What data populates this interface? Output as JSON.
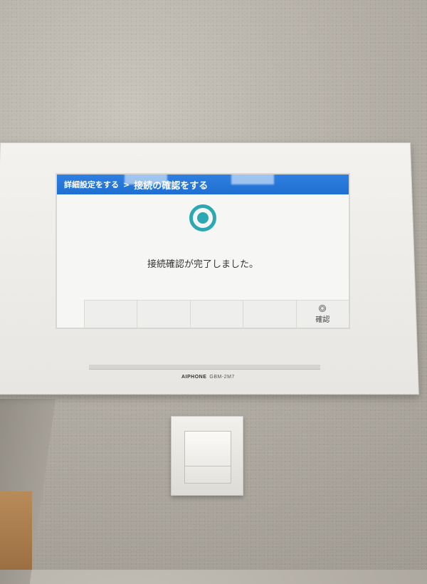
{
  "screen": {
    "breadcrumb": {
      "parent": "詳細設定をする",
      "separator": ">",
      "current": "接続の確認をする"
    },
    "message": "接続確認が完了しました。",
    "status_icon": "success-ring-icon",
    "accent_color": "#2ba8b2",
    "header_color": "#2f7fe0",
    "softkeys": [
      "",
      "",
      "",
      "",
      "確認"
    ]
  },
  "device": {
    "brand": "AIPHONE",
    "model": "GBM-2M7"
  }
}
